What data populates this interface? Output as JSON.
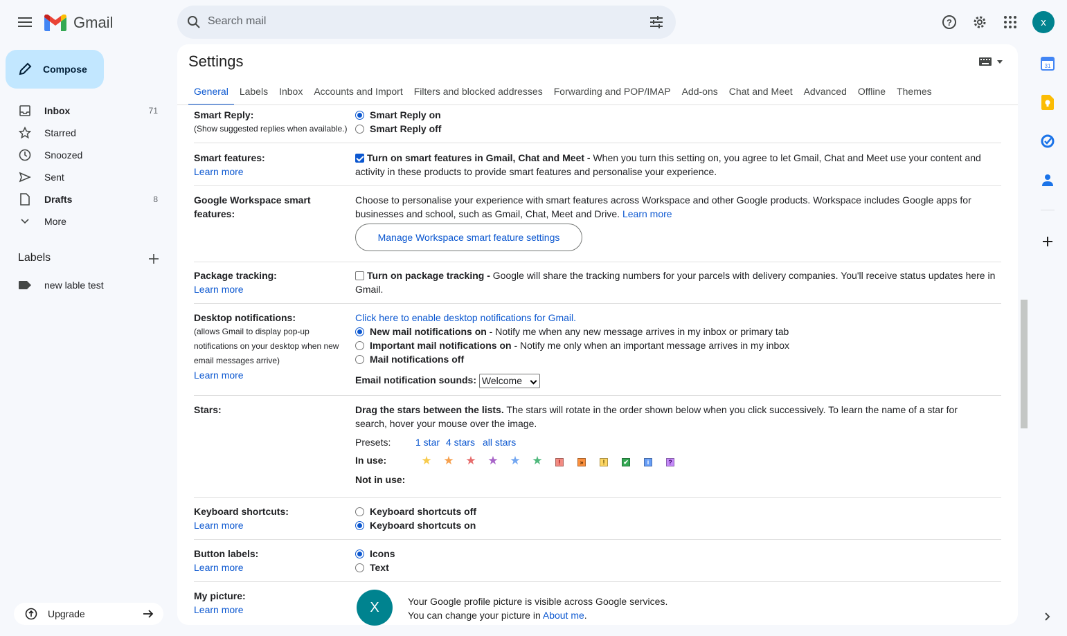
{
  "header": {
    "app_name": "Gmail",
    "search_placeholder": "Search mail",
    "avatar_letter": "x"
  },
  "compose_label": "Compose",
  "nav": [
    {
      "label": "Inbox",
      "count": "71",
      "bold": true
    },
    {
      "label": "Starred",
      "count": ""
    },
    {
      "label": "Snoozed",
      "count": ""
    },
    {
      "label": "Sent",
      "count": ""
    },
    {
      "label": "Drafts",
      "count": "8",
      "bold": true
    },
    {
      "label": "More",
      "count": ""
    }
  ],
  "labels": {
    "heading": "Labels",
    "items": [
      "new lable test"
    ]
  },
  "upgrade_label": "Upgrade",
  "settings": {
    "title": "Settings",
    "tabs": [
      "General",
      "Labels",
      "Inbox",
      "Accounts and Import",
      "Filters and blocked addresses",
      "Forwarding and POP/IMAP",
      "Add-ons",
      "Chat and Meet",
      "Advanced",
      "Offline",
      "Themes"
    ],
    "active_tab": "General",
    "smart_reply": {
      "label": "Smart Reply:",
      "sub": "(Show suggested replies when available.)",
      "on": "Smart Reply on",
      "off": "Smart Reply off"
    },
    "smart_features": {
      "label": "Smart features:",
      "learn": "Learn more",
      "bold": "Turn on smart features in Gmail, Chat and Meet -",
      "text": " When you turn this setting on, you agree to let Gmail, Chat and Meet use your content and activity in these products to provide smart features and personalise your experience."
    },
    "workspace": {
      "label": "Google Workspace smart features:",
      "text": "Choose to personalise your experience with smart features across Workspace and other Google products. Workspace includes Google apps for businesses and school, such as Gmail, Chat, Meet and Drive.",
      "learn": "Learn more",
      "button": "Manage Workspace smart feature settings"
    },
    "package": {
      "label": "Package tracking:",
      "learn": "Learn more",
      "bold": "Turn on package tracking -",
      "text": " Google will share the tracking numbers for your parcels with delivery companies. You'll receive status updates here in Gmail."
    },
    "desktop": {
      "label": "Desktop notifications:",
      "sub": "(allows Gmail to display pop-up notifications on your desktop when new email messages arrive)",
      "learn": "Learn more",
      "enable_link": "Click here to enable desktop notifications for Gmail.",
      "opt1_bold": "New mail notifications on",
      "opt1_text": " - Notify me when any new message arrives in my inbox or primary tab",
      "opt2_bold": "Important mail notifications on",
      "opt2_text": " - Notify me only when an important message arrives in my inbox",
      "opt3_bold": "Mail notifications off",
      "sound_label": "Email notification sounds:",
      "sound_value": "Welcome"
    },
    "stars": {
      "label": "Stars:",
      "bold": "Drag the stars between the lists.",
      "text": "  The stars will rotate in the order shown below when you click successively. To learn the name of a star for search, hover your mouse over the image.",
      "presets_label": "Presets:",
      "presets": [
        "1 star",
        "4 stars",
        "all stars"
      ],
      "in_use_label": "In use:",
      "not_in_use_label": "Not in use:"
    },
    "keyboard": {
      "label": "Keyboard shortcuts:",
      "learn": "Learn more",
      "off": "Keyboard shortcuts off",
      "on": "Keyboard shortcuts on"
    },
    "button_labels": {
      "label": "Button labels:",
      "learn": "Learn more",
      "icons": "Icons",
      "text": "Text"
    },
    "picture": {
      "label": "My picture:",
      "learn": "Learn more",
      "avatar": "X",
      "line1": "Your Google profile picture is visible across Google services.",
      "line2": "You can change your picture in",
      "about": "About me",
      "period": "."
    }
  },
  "colors": {
    "accent": "#0b57d0",
    "compose_bg": "#c2e7ff",
    "avatar": "#00838f"
  }
}
